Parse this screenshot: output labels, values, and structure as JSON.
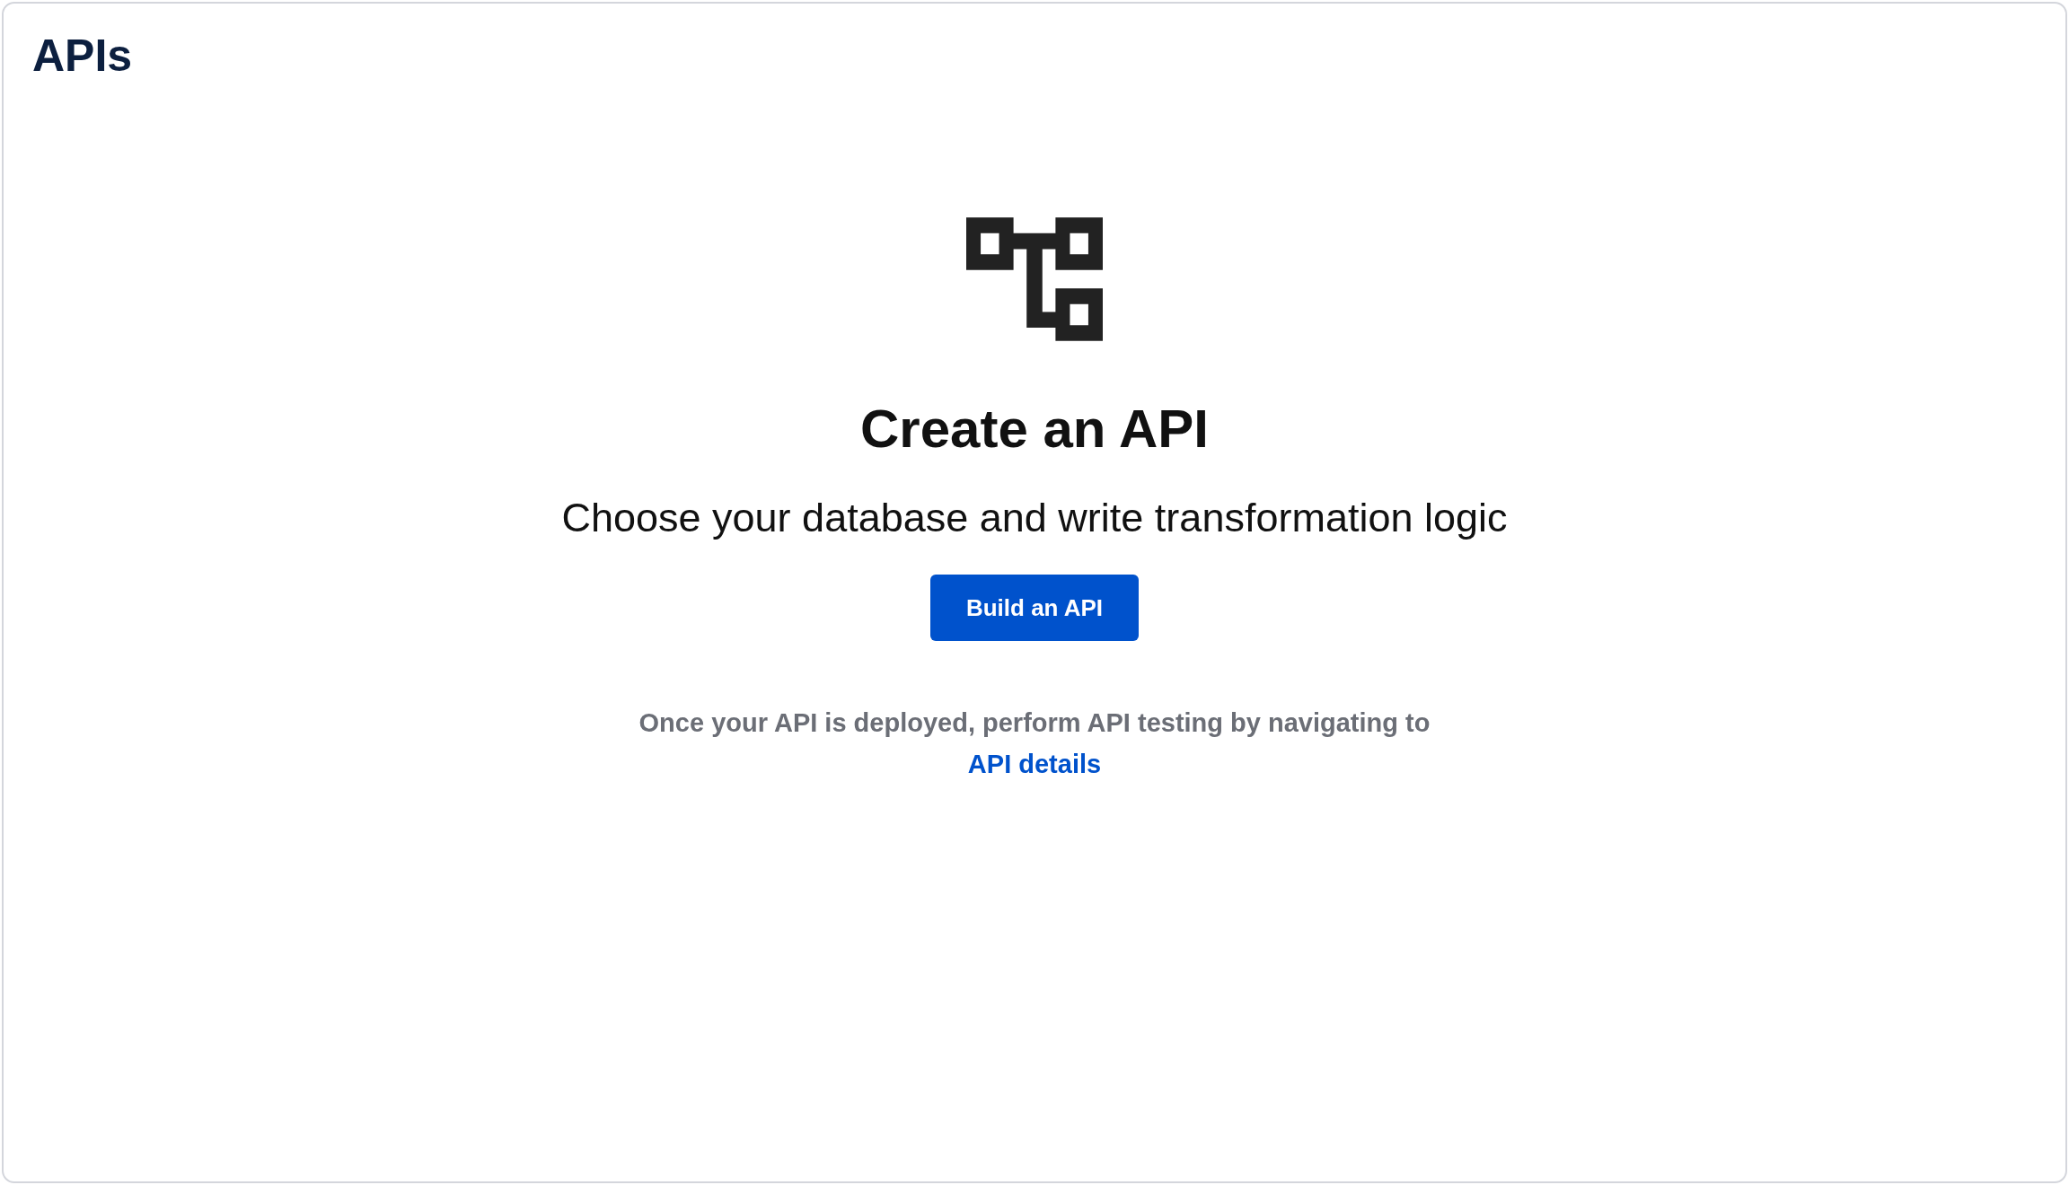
{
  "page": {
    "title": "APIs"
  },
  "empty_state": {
    "heading": "Create an API",
    "subtitle": "Choose your database and write transformation logic",
    "button": "Build an API",
    "note": {
      "text": "Once your API is deployed, perform API testing by navigating to",
      "link": "API details"
    }
  }
}
